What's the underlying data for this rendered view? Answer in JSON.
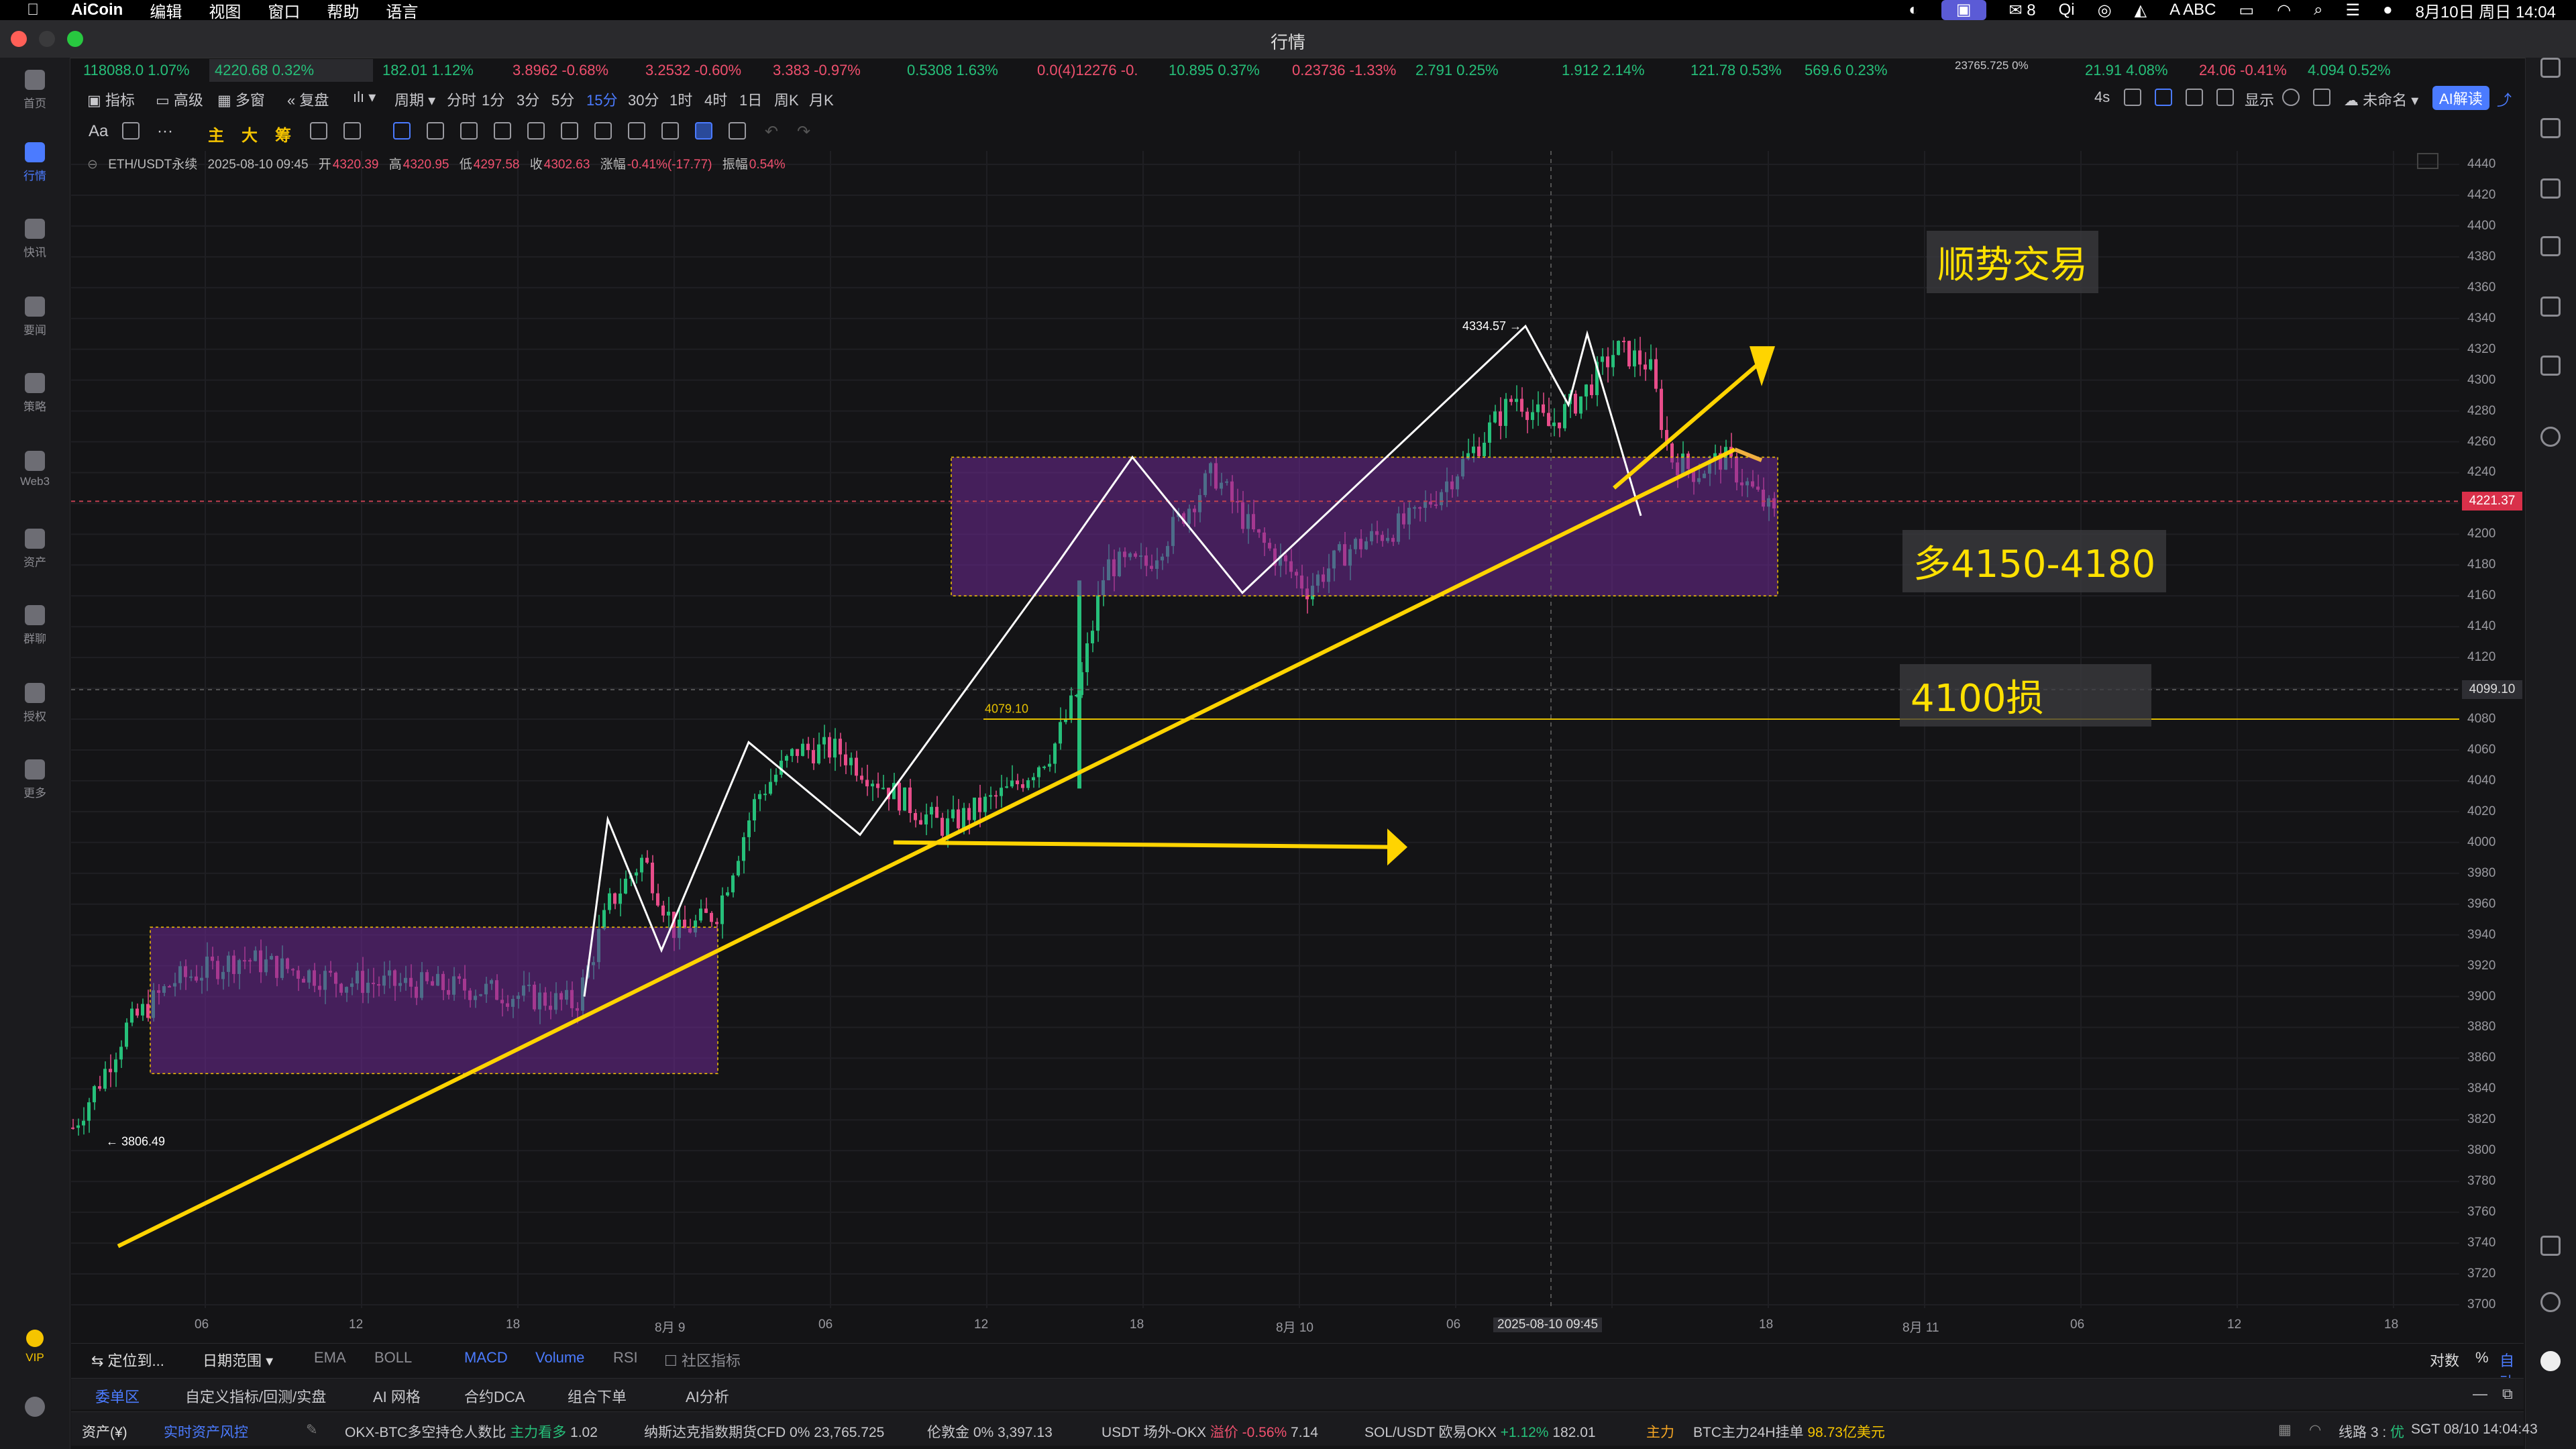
{
  "menubar": {
    "app": "AiCoin",
    "items": [
      "编辑",
      "视图",
      "窗口",
      "帮助",
      "语言"
    ],
    "wechat_count": "8",
    "input_method": "ABC",
    "datetime": "8月10日 周日 14:04"
  },
  "window": {
    "title": "行情"
  },
  "sidebar": {
    "items": [
      {
        "label": "首页",
        "icon": "home-icon"
      },
      {
        "label": "行情",
        "icon": "chart-bar-icon",
        "active": true
      },
      {
        "label": "快讯",
        "icon": "news-flash-icon"
      },
      {
        "label": "要闻",
        "icon": "headline-icon"
      },
      {
        "label": "策略",
        "icon": "strategy-icon"
      },
      {
        "label": "Web3",
        "icon": "web3-icon"
      },
      {
        "label": "资产",
        "icon": "wallet-icon"
      },
      {
        "label": "群聊",
        "icon": "chat-icon"
      },
      {
        "label": "授权",
        "icon": "authorize-icon"
      },
      {
        "label": "更多",
        "icon": "more-grid-icon"
      }
    ],
    "vip_label": "VIP"
  },
  "ticker": [
    {
      "text": "118088.0 1.07%",
      "dir": "up"
    },
    {
      "text": "4220.68 0.32%",
      "dir": "up"
    },
    {
      "text": "182.01 1.12%",
      "dir": "up"
    },
    {
      "text": "3.8962 -0.68%",
      "dir": "dn"
    },
    {
      "text": "3.2532 -0.60%",
      "dir": "dn"
    },
    {
      "text": "3.383 -0.97%",
      "dir": "dn"
    },
    {
      "text": "0.5308 1.63%",
      "dir": "up"
    },
    {
      "text": "0.0(4)12276 -0.",
      "dir": "dn"
    },
    {
      "text": "10.895 0.37%",
      "dir": "up"
    },
    {
      "text": "0.23736 -1.33%",
      "dir": "dn"
    },
    {
      "text": "2.791 0.25%",
      "dir": "up"
    },
    {
      "text": "1.912 2.14%",
      "dir": "up"
    },
    {
      "text": "121.78 0.53%",
      "dir": "up"
    },
    {
      "text": "569.6 0.23%",
      "dir": "up"
    },
    {
      "text": "23765.725 0%",
      "dir": "wh"
    },
    {
      "text": "21.91 4.08%",
      "dir": "up"
    },
    {
      "text": "24.06 -0.41%",
      "dir": "dn"
    },
    {
      "text": "4.094 0.52%",
      "dir": "up"
    }
  ],
  "toolbar1": {
    "indicator": "指标",
    "advanced": "高级",
    "multi_window": "多窗",
    "replay": "复盘",
    "period": "周期",
    "intervals": [
      "分时",
      "1分",
      "3分",
      "5分",
      "15分",
      "30分",
      "1时",
      "4时",
      "1日",
      "周K",
      "月K"
    ],
    "selected_interval": "15分",
    "right_refresh": "4s",
    "display": "显示",
    "unnamed": "未命名",
    "ai_read": "AI解读"
  },
  "toolbar2": {
    "font_tool": "Aa",
    "tag_main": "主",
    "tag_big": "大",
    "tag_chip": "筹"
  },
  "info": {
    "symbol": "ETH/USDT永续",
    "time": "2025-08-10 09:45",
    "open_label": "开",
    "open": "4320.39",
    "high_label": "高",
    "high": "4320.95",
    "low_label": "低",
    "low": "4297.58",
    "close_label": "收",
    "close": "4302.63",
    "change_label": "涨幅",
    "change": "-0.41%(-17.77)",
    "amp_label": "振幅",
    "amp": "0.54%"
  },
  "chart_data": {
    "type": "candlestick",
    "symbol": "ETH/USDT永续",
    "interval": "15分",
    "ylim": [
      3700,
      4440
    ],
    "y_ticks": [
      4440,
      4420,
      4400,
      4380,
      4360,
      4340,
      4320,
      4300,
      4280,
      4260,
      4240,
      4220,
      4200,
      4180,
      4160,
      4140,
      4120,
      4100,
      4080,
      4060,
      4040,
      4020,
      4000,
      3980,
      3960,
      3940,
      3920,
      3900,
      3880,
      3860,
      3840,
      3820,
      3800,
      3780,
      3760,
      3740,
      3720,
      3700
    ],
    "x_ticks": [
      "06",
      "12",
      "18",
      "8月 9",
      "06",
      "12",
      "18",
      "8月 10",
      "06",
      "2025-08-10 09:45",
      "18",
      "8月 11",
      "06",
      "12",
      "18"
    ],
    "current_price": "4221.37",
    "crosshair_price": "4099.10",
    "high_marker": "4334.57",
    "low_marker": "3806.49",
    "support_label": "4079.10",
    "support_level": 4080
  },
  "annotations": {
    "trend": "顺势交易",
    "long_zone": "多4150-4180",
    "stop_loss": "4100损"
  },
  "indicator_tabs": {
    "locate": "定位到...",
    "date_range": "日期范围",
    "items": [
      "EMA",
      "BOLL",
      "MACD",
      "Volume",
      "RSI"
    ],
    "selected": [
      "MACD",
      "Volume"
    ],
    "community": "社区指标",
    "right": [
      "对数",
      "%",
      "自动"
    ]
  },
  "tabs2": {
    "items": [
      "委单区",
      "自定义指标/回测/实盘",
      "AI 网格",
      "合约DCA",
      "组合下单",
      "AI分析"
    ]
  },
  "statusbar": {
    "assets": "资产(¥)",
    "realtime_risk": "实时资产风控",
    "items": [
      {
        "label": "OKX-BTC多空持仓人数比",
        "tag": "主力看多",
        "value": "1.02"
      },
      {
        "label": "纳斯达克指数期货CFD",
        "pct": "0%",
        "value": "23,765.725"
      },
      {
        "label": "伦敦金",
        "pct": "0%",
        "value": "3,397.13"
      },
      {
        "label": "USDT 场外-OKX",
        "tag": "溢价 -0.56%",
        "value": "7.14"
      },
      {
        "label": "SOL/USDT 欧易OKX",
        "pct": "+1.12%",
        "value": "182.01"
      }
    ],
    "main_label": "主力",
    "btc_main": "BTC主力24H挂单",
    "btc_main_value": "98.73亿美元",
    "line": "线路 3 :",
    "line_status": "优",
    "clock": "SGT 08/10 14:04:43"
  }
}
